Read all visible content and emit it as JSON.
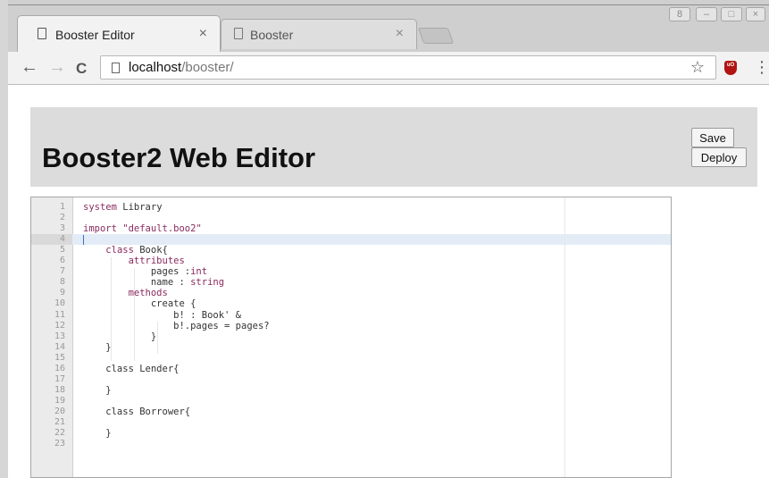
{
  "browser": {
    "tabs": [
      {
        "title": "Booster Editor",
        "close": "×",
        "active": true
      },
      {
        "title": "Booster",
        "close": "×",
        "active": false
      }
    ],
    "address": {
      "host": "localhost",
      "path": "/booster/"
    },
    "nav": {
      "back": "←",
      "forward": "→",
      "reload": "C"
    },
    "actions": {
      "bookmark": "☆",
      "menu": "⋮",
      "extension": "uO"
    },
    "window_controls": {
      "profile": "8",
      "minimize": "–",
      "maximize": "□",
      "close": "×"
    }
  },
  "page": {
    "title": "Booster2 Web Editor",
    "save_label": "Save",
    "deploy_label": "Deploy"
  },
  "editor": {
    "lines": [
      {
        "n": "1",
        "segs": [
          {
            "t": "system",
            "k": 1
          },
          {
            "t": " Library"
          }
        ]
      },
      {
        "n": "2",
        "segs": []
      },
      {
        "n": "3",
        "segs": [
          {
            "t": "import",
            "k": 1
          },
          {
            "t": " \"default.boo2\"",
            "s": 1
          }
        ]
      },
      {
        "n": "4",
        "segs": []
      },
      {
        "n": "5",
        "segs": [
          {
            "t": "    "
          },
          {
            "t": "class",
            "k": 1
          },
          {
            "t": " Book{"
          }
        ]
      },
      {
        "n": "6",
        "segs": [
          {
            "t": "        "
          },
          {
            "t": "attributes",
            "k": 1
          }
        ]
      },
      {
        "n": "7",
        "segs": [
          {
            "t": "            pages :"
          },
          {
            "t": "int",
            "k": 1
          }
        ]
      },
      {
        "n": "8",
        "segs": [
          {
            "t": "            name : "
          },
          {
            "t": "string",
            "k": 1
          }
        ]
      },
      {
        "n": "9",
        "segs": [
          {
            "t": "        "
          },
          {
            "t": "methods",
            "k": 1
          }
        ]
      },
      {
        "n": "10",
        "segs": [
          {
            "t": "            create {"
          }
        ]
      },
      {
        "n": "11",
        "segs": [
          {
            "t": "                b! : Book' &"
          }
        ]
      },
      {
        "n": "12",
        "segs": [
          {
            "t": "                b!.pages = pages?"
          }
        ]
      },
      {
        "n": "13",
        "segs": [
          {
            "t": "            }"
          }
        ]
      },
      {
        "n": "14",
        "segs": [
          {
            "t": "    }"
          }
        ]
      },
      {
        "n": "15",
        "segs": []
      },
      {
        "n": "16",
        "segs": [
          {
            "t": "    class Lender{"
          }
        ]
      },
      {
        "n": "17",
        "segs": []
      },
      {
        "n": "18",
        "segs": [
          {
            "t": "    }"
          }
        ]
      },
      {
        "n": "19",
        "segs": []
      },
      {
        "n": "20",
        "segs": [
          {
            "t": "    class Borrower{"
          }
        ]
      },
      {
        "n": "21",
        "segs": []
      },
      {
        "n": "22",
        "segs": [
          {
            "t": "    }"
          }
        ]
      },
      {
        "n": "23",
        "segs": []
      }
    ]
  }
}
